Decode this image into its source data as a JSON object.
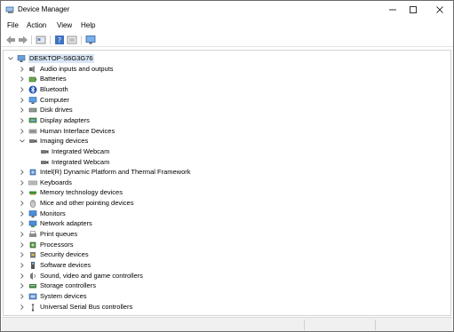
{
  "window": {
    "title": "Device Manager",
    "icon": "device-manager-icon",
    "controls": [
      "minimize-icon",
      "maximize-icon",
      "close-icon"
    ]
  },
  "menu": [
    "File",
    "Action",
    "View",
    "Help"
  ],
  "toolbar": [
    "back-arrow-icon",
    "forward-arrow-icon",
    "properties-icon",
    "help-icon",
    "view-icon",
    "monitor-icon"
  ],
  "tree": {
    "root": "DESKTOP-S6G3G76",
    "categories": [
      {
        "label": "Audio inputs and outputs",
        "icon": "speaker-icon",
        "expanded": false
      },
      {
        "label": "Batteries",
        "icon": "battery-icon",
        "expanded": false
      },
      {
        "label": "Bluetooth",
        "icon": "bluetooth-icon",
        "expanded": false
      },
      {
        "label": "Computer",
        "icon": "computer-icon",
        "expanded": false
      },
      {
        "label": "Disk drives",
        "icon": "disk-icon",
        "expanded": false
      },
      {
        "label": "Display adapters",
        "icon": "display-adapter-icon",
        "expanded": false
      },
      {
        "label": "Human Interface Devices",
        "icon": "hid-icon",
        "expanded": false
      },
      {
        "label": "Imaging devices",
        "icon": "camera-icon",
        "expanded": true,
        "children": [
          "Integrated Webcam",
          "Integrated Webcam"
        ]
      },
      {
        "label": "Intel(R) Dynamic Platform and Thermal Framework",
        "icon": "chip-icon",
        "expanded": false
      },
      {
        "label": "Keyboards",
        "icon": "keyboard-icon",
        "expanded": false
      },
      {
        "label": "Memory technology devices",
        "icon": "memory-icon",
        "expanded": false
      },
      {
        "label": "Mice and other pointing devices",
        "icon": "mouse-icon",
        "expanded": false
      },
      {
        "label": "Monitors",
        "icon": "monitor-icon",
        "expanded": false
      },
      {
        "label": "Network adapters",
        "icon": "network-icon",
        "expanded": false
      },
      {
        "label": "Print queues",
        "icon": "printer-icon",
        "expanded": false
      },
      {
        "label": "Processors",
        "icon": "processor-icon",
        "expanded": false
      },
      {
        "label": "Security devices",
        "icon": "security-icon",
        "expanded": false
      },
      {
        "label": "Software devices",
        "icon": "software-icon",
        "expanded": false
      },
      {
        "label": "Sound, video and game controllers",
        "icon": "sound-icon",
        "expanded": false
      },
      {
        "label": "Storage controllers",
        "icon": "storage-icon",
        "expanded": false
      },
      {
        "label": "System devices",
        "icon": "system-icon",
        "expanded": false
      },
      {
        "label": "Universal Serial Bus controllers",
        "icon": "usb-icon",
        "expanded": false
      }
    ]
  },
  "colors": {
    "selection": "#d9e6f5",
    "icon_blue": "#2f73c9",
    "icon_gray": "#6f6f6f",
    "chevron": "#6a6a6a"
  }
}
